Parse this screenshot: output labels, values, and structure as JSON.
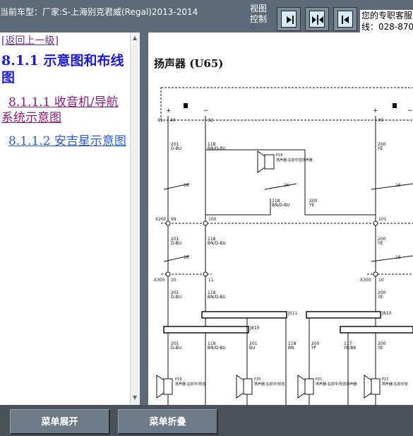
{
  "header": {
    "vehicle_label": "当前车型：厂家:S-上海别克君威(Regal)2013-2014",
    "view_control_label": "视图控制",
    "service_line1": "您的专职客服",
    "service_line2": "线：028-8707"
  },
  "toolbar": {
    "buttons": [
      {
        "name": "expand-right",
        "icon": "arrow-right-bar-icon"
      },
      {
        "name": "split-view",
        "icon": "split-arrows-icon"
      },
      {
        "name": "expand-left",
        "icon": "arrow-left-bar-icon"
      }
    ]
  },
  "nav": {
    "back_link": "[返回上一级]",
    "section_title": "8.1.1 示意图和布线图",
    "items": [
      {
        "label": "8.1.1.1 收音机/导航系统示意图"
      },
      {
        "label": "8.1.1.2 安吉星示意图"
      }
    ]
  },
  "diagram": {
    "title": "扬声器 (U65)",
    "connector_labels": {
      "x1": "X1",
      "x200_top": "X200",
      "x300_left": "X300",
      "x300_right": "X300",
      "j511": "J511",
      "j810": "J810",
      "j810b": "J810"
    },
    "pins_top": [
      "40",
      "32",
      "39"
    ],
    "pins_mid": [
      "99",
      "100",
      "101"
    ],
    "pins_low": [
      "10",
      "11",
      "10"
    ],
    "wire_labels": {
      "w201_dbu": "201\nD-BU",
      "w118_bnd_bu": "118\nBN/D-BU",
      "w200_ye": "200\nYE",
      "w201_dbu2": "201\nD-BU",
      "w118_2": "118\nBN/D-BU",
      "w200_ye2": "200\nYE",
      "w118_3": "118\nBN/D-BU",
      "w200_3": "200\nYE",
      "w201_4": "201\nD-BU",
      "w118_4": "118\nBN/D-BU",
      "w201_bu": "201\nBU",
      "w118_bn": "118\nBN",
      "w200_yf": "200\nYF",
      "w117_yebk": "117\nYE/BK",
      "w200_ye4": "200\nYE"
    },
    "bus_num": "16",
    "speakers": [
      {
        "id": "P18",
        "desc": "扬声器-左前中音扬声器"
      },
      {
        "id": "P19",
        "desc": "扬声器-左前中/低音"
      },
      {
        "id": "P20",
        "desc": "扬声器-右前中/低音"
      },
      {
        "id": "P21",
        "desc": "扬声器-右前中/低音扬声器"
      },
      {
        "id": "P22",
        "desc": "扬声器-右前中音"
      }
    ],
    "polarity_plus": "+",
    "polarity_minus": "−"
  },
  "footer": {
    "expand_label": "菜单展开",
    "collapse_label": "菜单折叠"
  }
}
